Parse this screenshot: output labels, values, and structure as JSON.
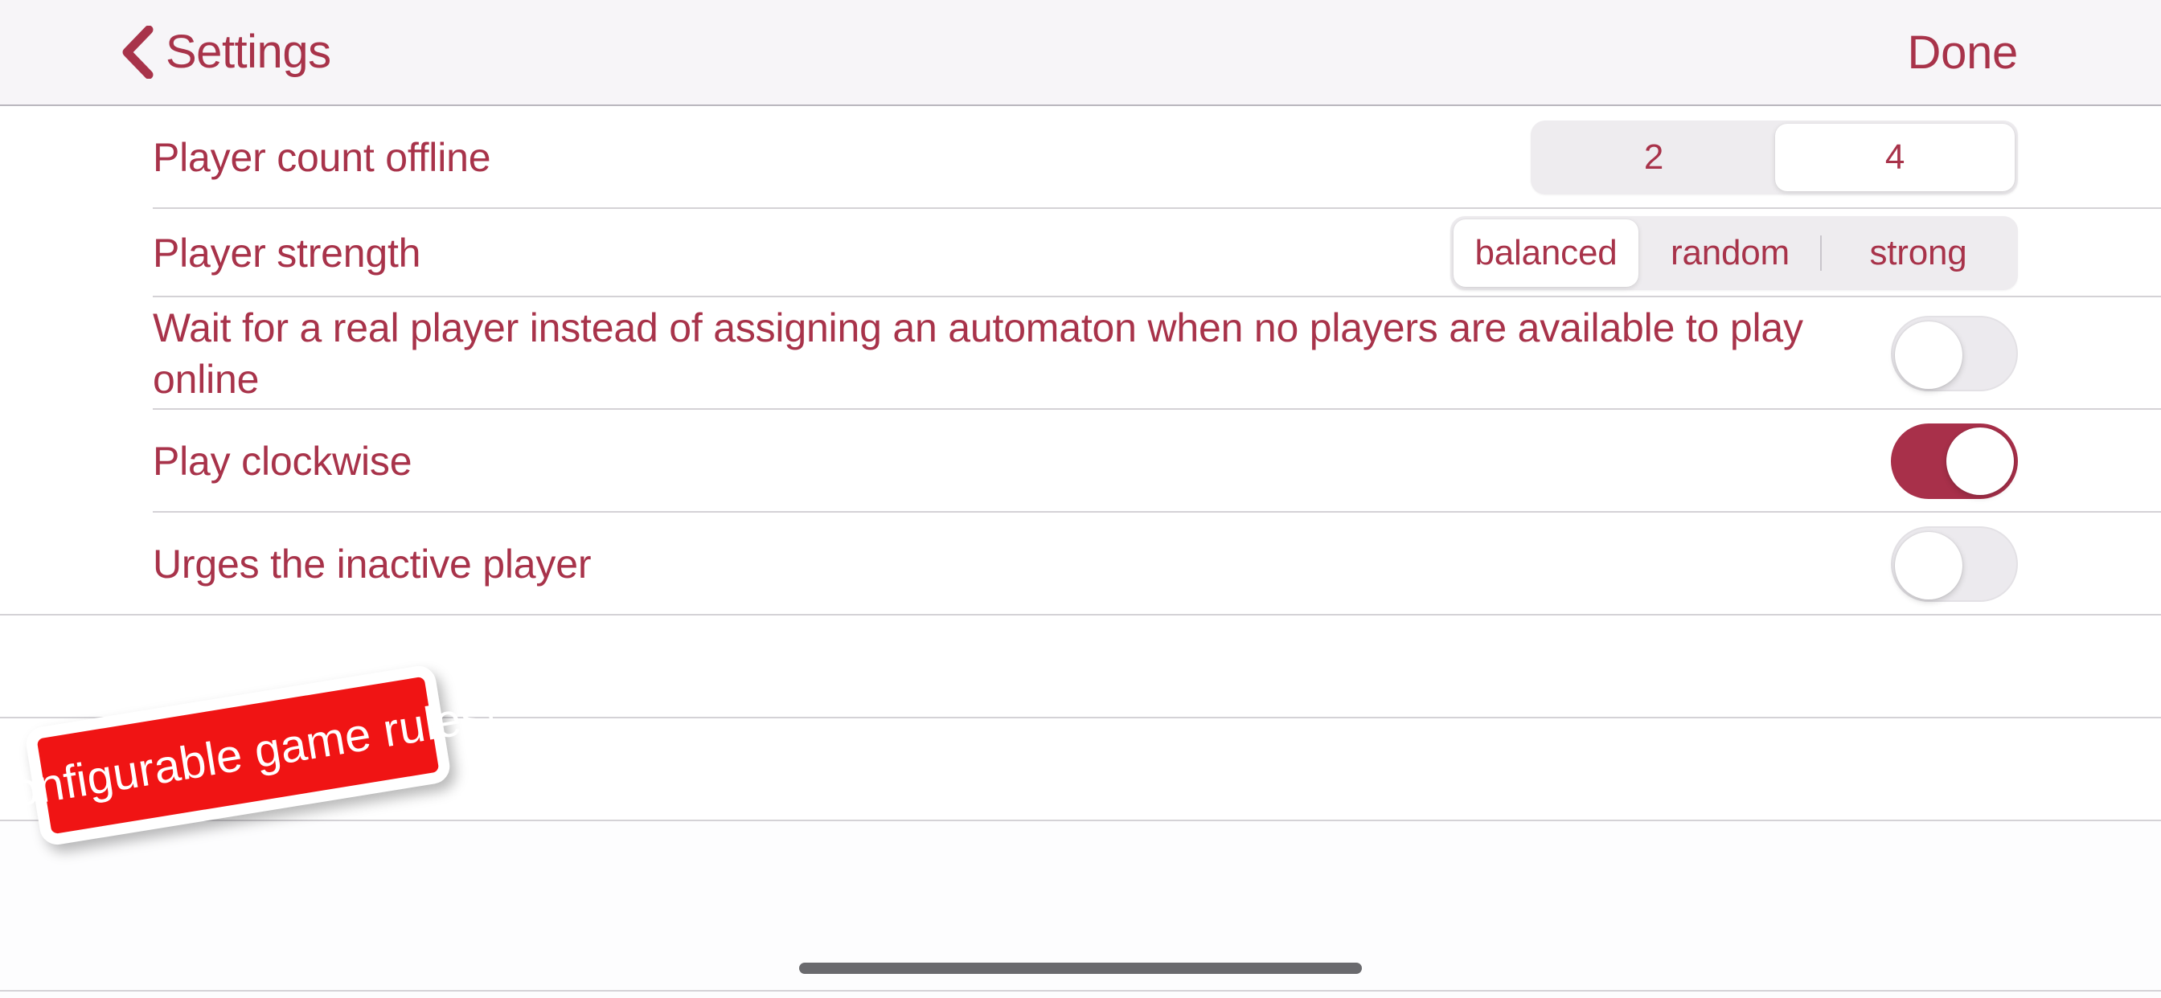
{
  "navbar": {
    "back_icon": "chevron-left-icon",
    "back_label": "Settings",
    "done_label": "Done"
  },
  "settings_rows": [
    {
      "label": "Player count offline",
      "control": "segmented",
      "options": [
        "2",
        "4"
      ],
      "selected": "4"
    },
    {
      "label": "Player strength",
      "control": "segmented",
      "options": [
        "balanced",
        "random",
        "strong"
      ],
      "selected": "balanced"
    },
    {
      "label": "Wait for a real player instead of assigning an automaton when no players are available to play online",
      "control": "switch",
      "value": "off"
    },
    {
      "label": "Play clockwise",
      "control": "switch",
      "value": "on"
    },
    {
      "label": "Urges the inactive player",
      "control": "switch",
      "value": "off"
    }
  ],
  "sticker": {
    "text": "Configurable game rules!",
    "background_color": "#f01414",
    "text_color": "#ffffff"
  },
  "theme": {
    "accent_color": "#a8334a",
    "switch_on_color": "#a8304a",
    "navbar_background": "#f7f5f8",
    "row_background": "#ffffff",
    "divider_color": "#d4d2d6",
    "segment_track_color": "#eeecef",
    "segment_selected_color": "#ffffff"
  },
  "home_indicator": {
    "color": "#6a6a6e"
  }
}
